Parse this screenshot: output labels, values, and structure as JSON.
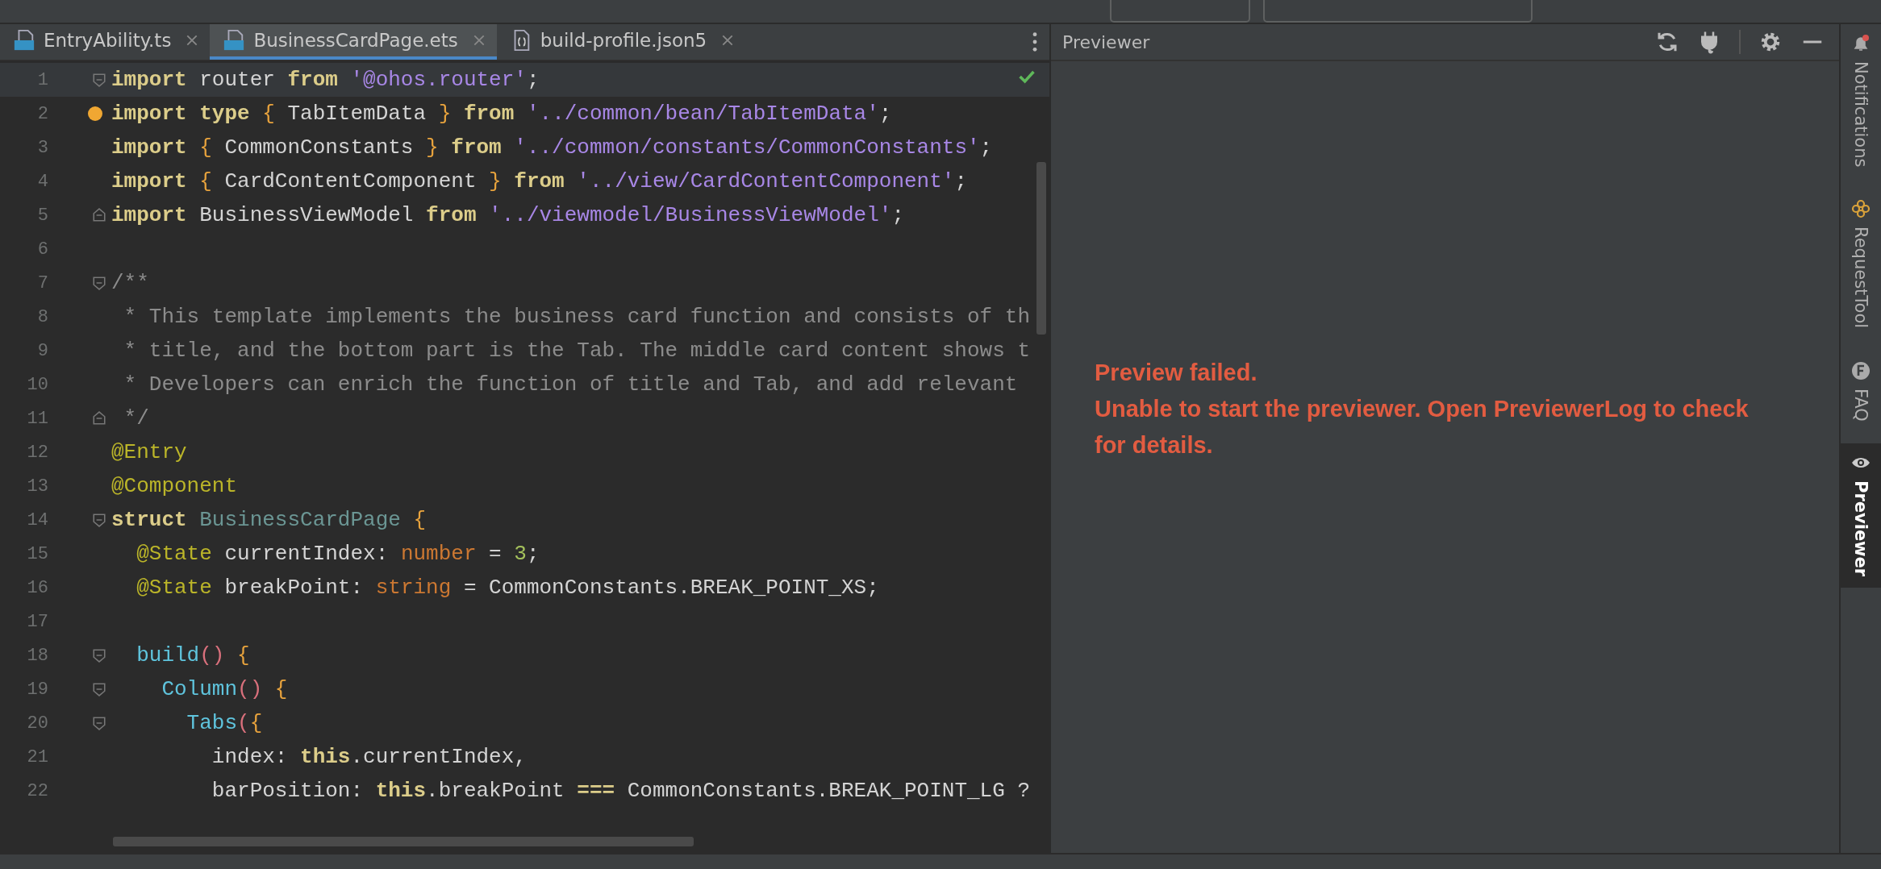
{
  "tabs": [
    {
      "label": "EntryAbility.ts",
      "kind": "ts",
      "selected": false
    },
    {
      "label": "BusinessCardPage.ets",
      "kind": "ets",
      "selected": true
    },
    {
      "label": "build-profile.json5",
      "kind": "json",
      "selected": false
    }
  ],
  "code": [
    {
      "n": "1",
      "fold_start": true,
      "fold_end": false,
      "current": true,
      "bulb": false,
      "tokens": [
        {
          "t": "import ",
          "kind": "kw"
        },
        {
          "t": "router ",
          "kind": "tx"
        },
        {
          "t": "from ",
          "kind": "kw"
        },
        {
          "t": "'@ohos.router'",
          "kind": "str"
        },
        {
          "t": ";",
          "kind": "tx"
        }
      ]
    },
    {
      "n": "2",
      "fold_start": false,
      "fold_end": false,
      "current": false,
      "bulb": true,
      "tokens": [
        {
          "t": "import ",
          "kind": "kw"
        },
        {
          "t": "type ",
          "kind": "kw"
        },
        {
          "t": "{ ",
          "kind": "br"
        },
        {
          "t": "TabItemData ",
          "kind": "tx"
        },
        {
          "t": "} ",
          "kind": "br"
        },
        {
          "t": "from ",
          "kind": "kw"
        },
        {
          "t": "'../common/bean/TabItemData'",
          "kind": "str"
        },
        {
          "t": ";",
          "kind": "tx"
        }
      ]
    },
    {
      "n": "3",
      "fold_start": false,
      "fold_end": false,
      "current": false,
      "bulb": false,
      "tokens": [
        {
          "t": "import ",
          "kind": "kw"
        },
        {
          "t": "{ ",
          "kind": "br"
        },
        {
          "t": "CommonConstants ",
          "kind": "tx"
        },
        {
          "t": "} ",
          "kind": "br"
        },
        {
          "t": "from ",
          "kind": "kw"
        },
        {
          "t": "'../common/constants/CommonConstants'",
          "kind": "str"
        },
        {
          "t": ";",
          "kind": "tx"
        }
      ]
    },
    {
      "n": "4",
      "fold_start": false,
      "fold_end": false,
      "current": false,
      "bulb": false,
      "tokens": [
        {
          "t": "import ",
          "kind": "kw"
        },
        {
          "t": "{ ",
          "kind": "br"
        },
        {
          "t": "CardContentComponent ",
          "kind": "tx"
        },
        {
          "t": "} ",
          "kind": "br"
        },
        {
          "t": "from ",
          "kind": "kw"
        },
        {
          "t": "'../view/CardContentComponent'",
          "kind": "str"
        },
        {
          "t": ";",
          "kind": "tx"
        }
      ]
    },
    {
      "n": "5",
      "fold_start": false,
      "fold_end": true,
      "current": false,
      "bulb": false,
      "tokens": [
        {
          "t": "import ",
          "kind": "kw"
        },
        {
          "t": "BusinessViewModel ",
          "kind": "tx"
        },
        {
          "t": "from ",
          "kind": "kw"
        },
        {
          "t": "'../viewmodel/BusinessViewModel'",
          "kind": "str"
        },
        {
          "t": ";",
          "kind": "tx"
        }
      ]
    },
    {
      "n": "6",
      "fold_start": false,
      "fold_end": false,
      "current": false,
      "bulb": false
    },
    {
      "n": "7",
      "fold_start": true,
      "fold_end": false,
      "current": false,
      "bulb": false,
      "tokens": [
        {
          "t": "/**",
          "kind": "cm"
        }
      ]
    },
    {
      "n": "8",
      "fold_start": false,
      "fold_end": false,
      "current": false,
      "bulb": false,
      "tokens": [
        {
          "t": " * This template implements the business card function and consists of th",
          "kind": "cm"
        }
      ]
    },
    {
      "n": "9",
      "fold_start": false,
      "fold_end": false,
      "current": false,
      "bulb": false,
      "tokens": [
        {
          "t": " * title, and the bottom part is the Tab. The middle card content shows t",
          "kind": "cm"
        }
      ]
    },
    {
      "n": "10",
      "fold_start": false,
      "fold_end": false,
      "current": false,
      "bulb": false,
      "tokens": [
        {
          "t": " * Developers can enrich the function of title and Tab, and add relevant",
          "kind": "cm"
        }
      ]
    },
    {
      "n": "11",
      "fold_start": false,
      "fold_end": true,
      "current": false,
      "bulb": false,
      "tokens": [
        {
          "t": " */",
          "kind": "cm"
        }
      ]
    },
    {
      "n": "12",
      "fold_start": false,
      "fold_end": false,
      "current": false,
      "bulb": false,
      "tokens": [
        {
          "t": "@Entry",
          "kind": "dec"
        }
      ]
    },
    {
      "n": "13",
      "fold_start": false,
      "fold_end": false,
      "current": false,
      "bulb": false,
      "tokens": [
        {
          "t": "@Component",
          "kind": "dec"
        }
      ]
    },
    {
      "n": "14",
      "fold_start": true,
      "fold_end": false,
      "current": false,
      "bulb": false,
      "tokens": [
        {
          "t": "struct ",
          "kind": "kw"
        },
        {
          "t": "BusinessCardPage ",
          "kind": "cls"
        },
        {
          "t": "{",
          "kind": "br"
        }
      ]
    },
    {
      "n": "15",
      "fold_start": false,
      "fold_end": false,
      "current": false,
      "bulb": false,
      "tokens": [
        {
          "t": "  @State",
          "kind": "dec"
        },
        {
          "t": " currentIndex: ",
          "kind": "tx"
        },
        {
          "t": "number",
          "kind": "type"
        },
        {
          "t": " = ",
          "kind": "tx"
        },
        {
          "t": "3",
          "kind": "num"
        },
        {
          "t": ";",
          "kind": "tx"
        }
      ]
    },
    {
      "n": "16",
      "fold_start": false,
      "fold_end": false,
      "current": false,
      "bulb": false,
      "tokens": [
        {
          "t": "  @State",
          "kind": "dec"
        },
        {
          "t": " breakPoint: ",
          "kind": "tx"
        },
        {
          "t": "string",
          "kind": "type"
        },
        {
          "t": " = CommonConstants.BREAK_POINT_XS;",
          "kind": "tx"
        }
      ]
    },
    {
      "n": "17",
      "fold_start": false,
      "fold_end": false,
      "current": false,
      "bulb": false
    },
    {
      "n": "18",
      "fold_start": true,
      "fold_end": false,
      "current": false,
      "bulb": false,
      "tokens": [
        {
          "t": "  build",
          "kind": "fn"
        },
        {
          "t": "() ",
          "kind": "par"
        },
        {
          "t": "{",
          "kind": "br"
        }
      ]
    },
    {
      "n": "19",
      "fold_start": true,
      "fold_end": false,
      "current": false,
      "bulb": false,
      "tokens": [
        {
          "t": "    Column",
          "kind": "fn"
        },
        {
          "t": "() ",
          "kind": "par"
        },
        {
          "t": "{",
          "kind": "br"
        }
      ]
    },
    {
      "n": "20",
      "fold_start": true,
      "fold_end": false,
      "current": false,
      "bulb": false,
      "tokens": [
        {
          "t": "      Tabs",
          "kind": "fn"
        },
        {
          "t": "(",
          "kind": "par"
        },
        {
          "t": "{",
          "kind": "br"
        }
      ]
    },
    {
      "n": "21",
      "fold_start": false,
      "fold_end": false,
      "current": false,
      "bulb": false,
      "tokens": [
        {
          "t": "        index: ",
          "kind": "tx"
        },
        {
          "t": "this",
          "kind": "kw"
        },
        {
          "t": ".currentIndex,",
          "kind": "tx"
        }
      ]
    },
    {
      "n": "22",
      "fold_start": false,
      "fold_end": false,
      "current": false,
      "bulb": false,
      "tokens": [
        {
          "t": "        barPosition: ",
          "kind": "tx"
        },
        {
          "t": "this",
          "kind": "kw"
        },
        {
          "t": ".breakPoint ",
          "kind": "tx"
        },
        {
          "t": "===",
          "kind": "kw"
        },
        {
          "t": " CommonConstants.BREAK_POINT_LG ?",
          "kind": "tx"
        }
      ]
    }
  ],
  "previewer": {
    "title": "Previewer",
    "error_lines": [
      "Preview failed.",
      "Unable to start the previewer. Open PreviewerLog to check for details."
    ]
  },
  "sidebar": [
    {
      "label": "Notifications",
      "kind": "bell",
      "selected": false
    },
    {
      "label": "RequestTool",
      "kind": "knot",
      "selected": false
    },
    {
      "label": "FAQ",
      "kind": "faq",
      "selected": false
    },
    {
      "label": "Previewer",
      "kind": "eye",
      "selected": true
    }
  ]
}
